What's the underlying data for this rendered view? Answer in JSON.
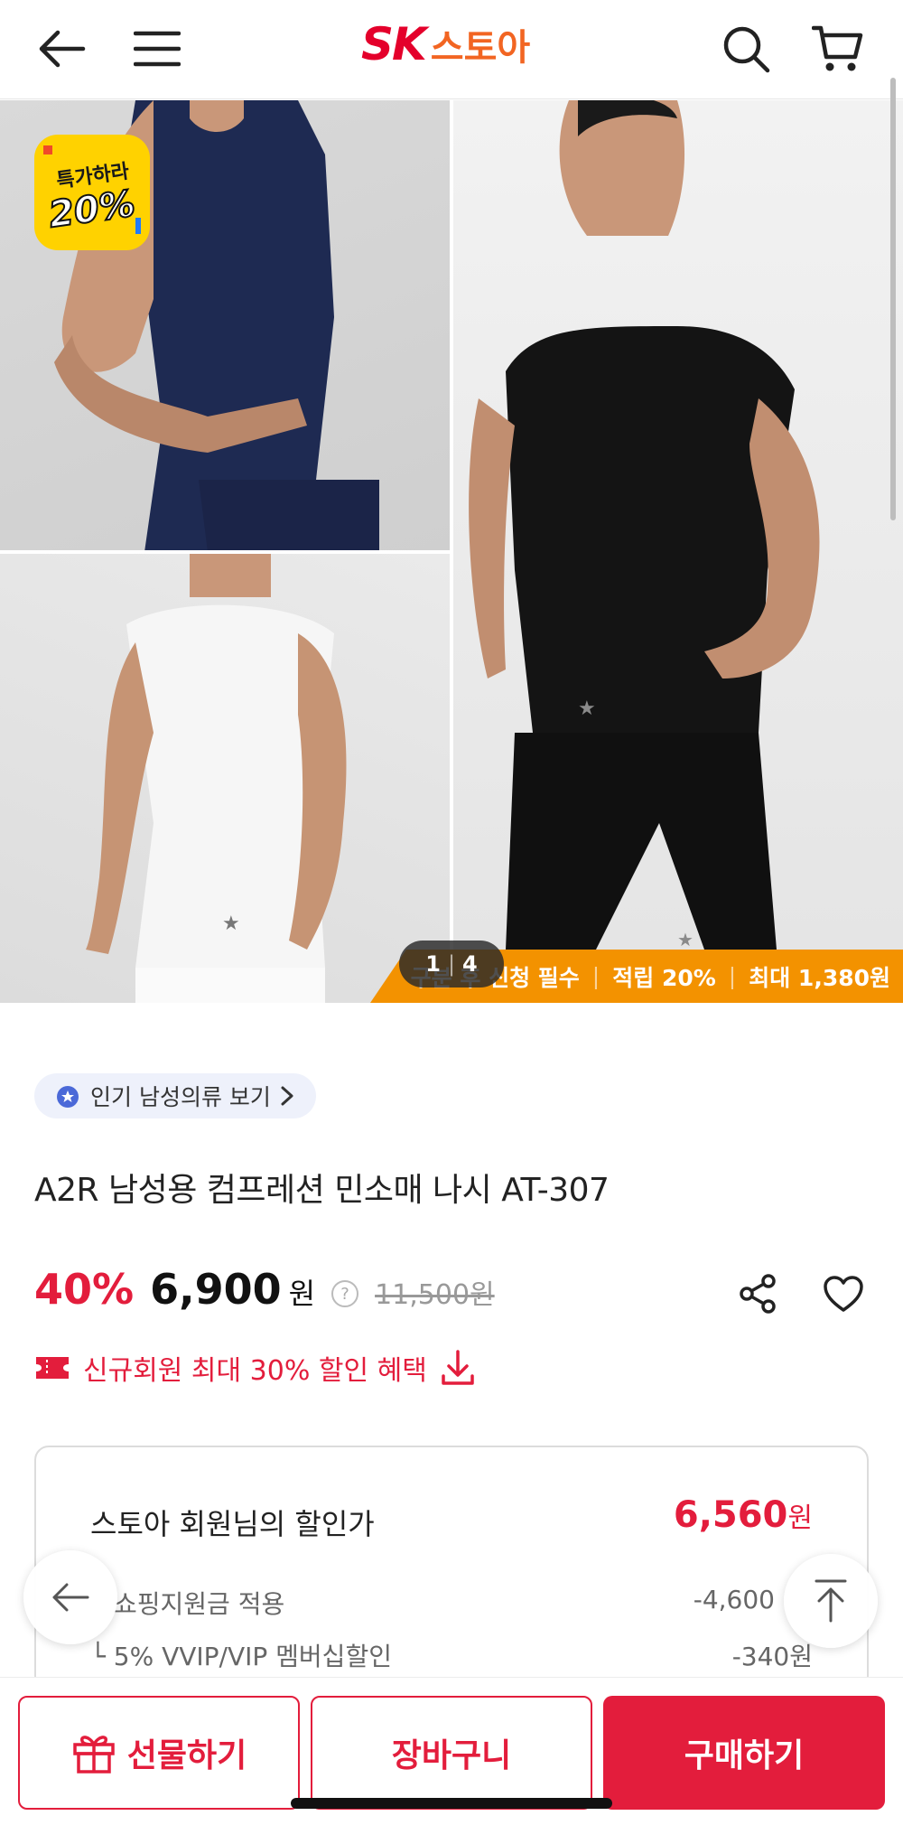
{
  "header": {
    "logo_brand": "SK",
    "logo_store": "스토아"
  },
  "gallery": {
    "badge_line1": "특가하라",
    "badge_line2": "20%",
    "counter_current": "1",
    "counter_total": "4",
    "banner_item1": "구분 후 신청 필수",
    "banner_item2": "적립 20%",
    "banner_item3": "최대 1,380원"
  },
  "product": {
    "category_link": "인기 남성의류 보기",
    "title": "A2R 남성용 컴프레션 민소매 나시 AT-307",
    "discount_rate": "40%",
    "price": "6,900",
    "price_unit": "원",
    "help_mark": "?",
    "original_price": "11,500원",
    "coupon_text": "신규회원 최대 30% 할인 혜택"
  },
  "member_discount": {
    "title": "스토아 회원님의 할인가",
    "price": "6,560",
    "price_unit": "원",
    "line1_label": "쇼핑지원금 적용",
    "line1_value": "-4,600",
    "line2_label": "└ 5% VVIP/VIP 멤버십할인",
    "line2_value": "-340원"
  },
  "bottom_bar": {
    "gift_label": "선물하기",
    "cart_label": "장바구니",
    "buy_label": "구매하기"
  },
  "colors": {
    "accent_red": "#e31d3c",
    "brand_orange": "#f26522",
    "banner_orange": "#f39200",
    "badge_yellow": "#ffd200"
  }
}
